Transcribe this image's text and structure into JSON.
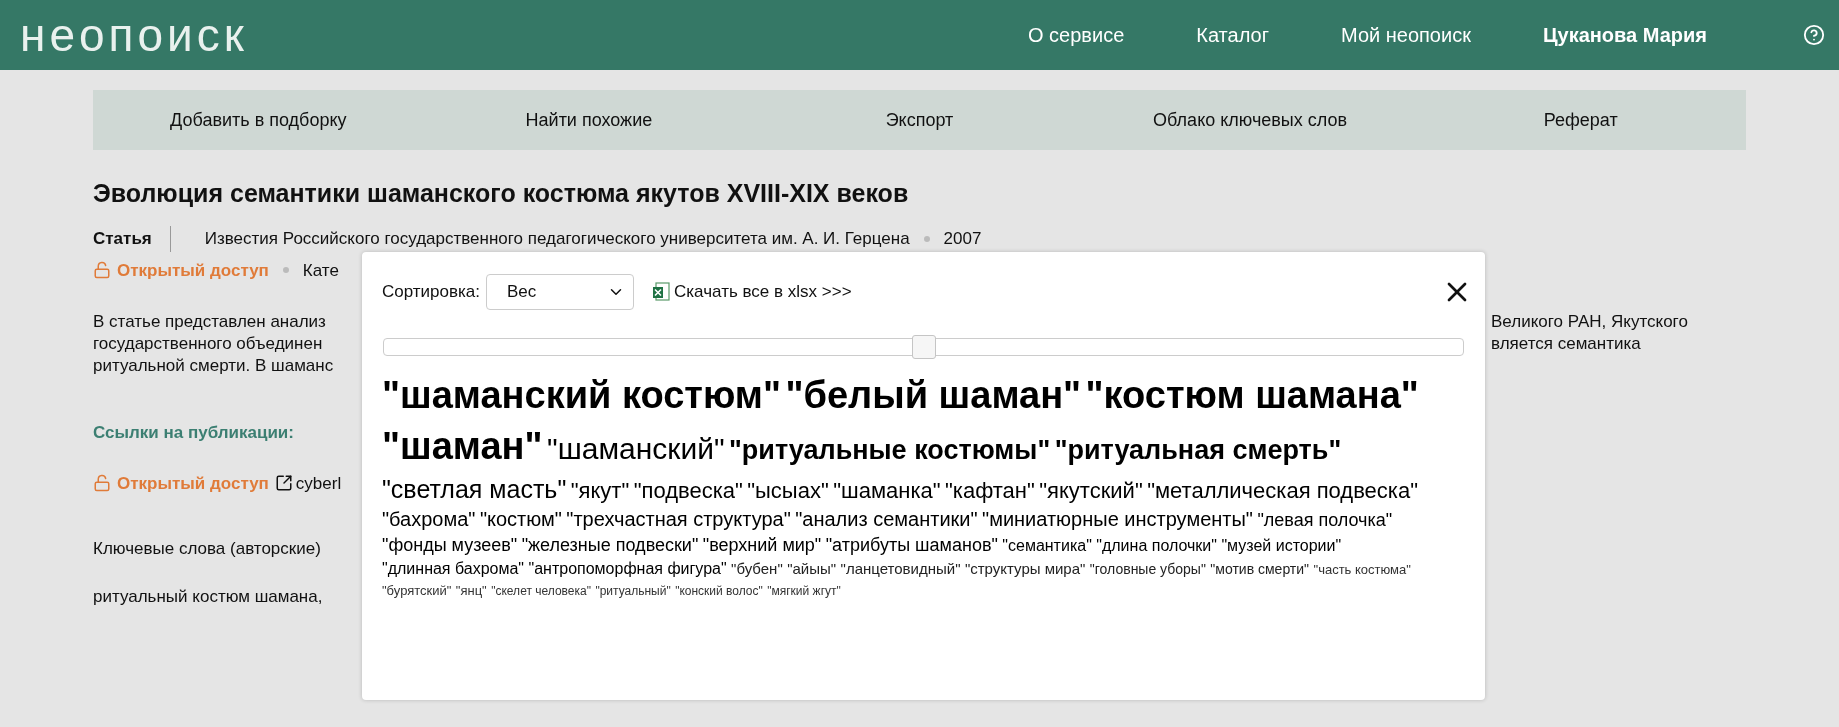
{
  "header": {
    "logo": "неопоиск",
    "nav": [
      {
        "label": "О сервисе",
        "selected": false
      },
      {
        "label": "Каталог",
        "selected": false
      },
      {
        "label": "Мой неопоиск",
        "selected": false
      },
      {
        "label": "Цуканова Мария",
        "selected": true
      }
    ]
  },
  "toolbar": [
    "Добавить в подборку",
    "Найти похожие",
    "Экспорт",
    "Облако ключевых слов",
    "Реферат"
  ],
  "article": {
    "title": "Эволюция семантики шаманского костюма якутов XVIII-XIX веков",
    "type": "Статья",
    "journal": "Известия Российского государственного педагогического университета им. А. И. Герцена",
    "year": "2007",
    "access": "Открытый доступ",
    "category": "Кате",
    "abstract_left": [
      "В статье представлен анализ",
      "государственного объединен",
      "ритуальной смерти. В шаманс"
    ],
    "abstract_right": [
      "Великого РАН, Якутского",
      "вляется семантика"
    ],
    "links_heading": "Ссылки на публикации:",
    "link_access": "Открытый доступ",
    "link_site": "cyberl",
    "keywords_label": "Ключевые слова (авторские)",
    "keywords_value": "ритуальный костюм шамана,"
  },
  "modal": {
    "sort_label": "Сортировка:",
    "sort_value": "Вес",
    "download": "Скачать все в xlsx >>>",
    "slider": {
      "level": 0.5
    },
    "tags": [
      {
        "text": "\"шаманский костюм\"",
        "kind": "giant"
      },
      {
        "text": "\"белый шаман\"",
        "kind": "giant"
      },
      {
        "text": "\"костюм шамана\"",
        "kind": "giant"
      },
      {
        "text": "\"шаман\"",
        "kind": "giant"
      },
      {
        "text": "\"шаманский\"",
        "kind": "huge"
      },
      {
        "text": "\"ритуальные костюмы\"",
        "kind": "big"
      },
      {
        "text": "\"ритуальная смерть\"",
        "kind": "big"
      },
      {
        "text": "\"светлая масть\"",
        "kind": "large"
      },
      {
        "text": "\"якут\"",
        "kind": "medium"
      },
      {
        "text": "\"подвеска\"",
        "kind": "medium"
      },
      {
        "text": "\"ысыах\"",
        "kind": "medium"
      },
      {
        "text": "\"шаманка\"",
        "kind": "medium"
      },
      {
        "text": "\"кафтан\"",
        "kind": "medium"
      },
      {
        "text": "\"якутский\"",
        "kind": "medium"
      },
      {
        "text": "\"металлическая подвеска\"",
        "kind": "medium"
      },
      {
        "text": "\"бахрома\"",
        "kind": "normal"
      },
      {
        "text": "\"костюм\"",
        "kind": "normal"
      },
      {
        "text": "\"трехчастная структура\"",
        "kind": "normal"
      },
      {
        "text": "\"анализ семантики\"",
        "kind": "normal"
      },
      {
        "text": "\"миниатюрные инструменты\"",
        "kind": "normal"
      },
      {
        "text": "\"левая полочка\"",
        "kind": "small"
      },
      {
        "text": "\"фонды музеев\"",
        "kind": "small"
      },
      {
        "text": "\"железные подвески\"",
        "kind": "small"
      },
      {
        "text": "\"верхний мир\"",
        "kind": "small"
      },
      {
        "text": "\"атрибуты шаманов\"",
        "kind": "small"
      },
      {
        "text": "\"семантика\"",
        "kind": "smaller"
      },
      {
        "text": "\"длина полочки\"",
        "kind": "smaller"
      },
      {
        "text": "\"музей истории\"",
        "kind": "smaller"
      },
      {
        "text": "\"длинная бахрома\"",
        "kind": "smaller"
      },
      {
        "text": "\"антропоморфная фигура\"",
        "kind": "smaller"
      },
      {
        "text": "\"бубен\"",
        "kind": "little"
      },
      {
        "text": "\"айыы\"",
        "kind": "little"
      },
      {
        "text": "\"ланцетовидный\"",
        "kind": "little"
      },
      {
        "text": "\"структуры мира\"",
        "kind": "little"
      },
      {
        "text": "\"головные уборы\"",
        "kind": "tiny"
      },
      {
        "text": "\"мотив смерти\"",
        "kind": "tiny"
      },
      {
        "text": "\"часть костюма\"",
        "kind": "minute"
      },
      {
        "text": "\"бурятский\"",
        "kind": "minute"
      },
      {
        "text": "\"янц\"",
        "kind": "minute"
      },
      {
        "text": "\"скелет человека\"",
        "kind": "micro"
      },
      {
        "text": "\"ритуальный\"",
        "kind": "micro"
      },
      {
        "text": "\"конский волос\"",
        "kind": "micro"
      },
      {
        "text": "\"мягкий жгут\"",
        "kind": "micro"
      }
    ]
  }
}
